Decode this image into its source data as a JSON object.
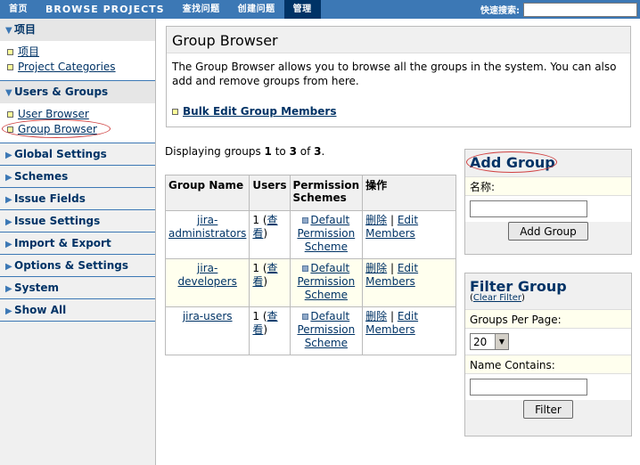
{
  "nav": {
    "items": [
      "首页",
      "BROWSE PROJECTS",
      "查找问题",
      "创建问题",
      "管理"
    ],
    "quick_search_label": "快速搜索:"
  },
  "sidebar": {
    "projects": {
      "title": "项目",
      "items": [
        "项目",
        "Project Categories"
      ]
    },
    "users_groups": {
      "title": "Users & Groups",
      "items": [
        "User Browser",
        "Group Browser"
      ]
    },
    "sections": [
      "Global Settings",
      "Schemes",
      "Issue Fields",
      "Issue Settings",
      "Import & Export",
      "Options & Settings",
      "System",
      "Show All"
    ]
  },
  "browser": {
    "title": "Group Browser",
    "description": "The Group Browser allows you to browse all the groups in the system. You can also add and remove groups from here.",
    "bulk_edit": "Bulk Edit Group Members"
  },
  "displaying": {
    "prefix": "Displaying groups ",
    "from": "1",
    "to_word": " to ",
    "to": "3",
    "of_word": " of ",
    "total": "3",
    "suffix": "."
  },
  "table": {
    "headers": [
      "Group Name",
      "Users",
      "Permission Schemes",
      "操作"
    ],
    "rows": [
      {
        "name": "jira-administrators",
        "users": "1",
        "view": "查看",
        "scheme": "Default Permission Scheme",
        "delete": "删除",
        "edit": "Edit Members"
      },
      {
        "name": "jira-developers",
        "users": "1",
        "view": "查看",
        "scheme": "Default Permission Scheme",
        "delete": "删除",
        "edit": "Edit Members"
      },
      {
        "name": "jira-users",
        "users": "1",
        "view": "查看",
        "scheme": "Default Permission Scheme",
        "delete": "删除",
        "edit": "Edit Members"
      }
    ]
  },
  "add_group": {
    "title": "Add Group",
    "name_label": "名称:",
    "button": "Add Group"
  },
  "filter_group": {
    "title": "Filter Group",
    "clear_filter": "Clear Filter",
    "per_page_label": "Groups Per Page:",
    "per_page_value": "20",
    "name_contains_label": "Name Contains:",
    "button": "Filter"
  },
  "colors": {
    "nav_bg": "#3c78b5",
    "nav_active": "#003366",
    "link": "#003366",
    "highlight_circle": "#d04040"
  }
}
